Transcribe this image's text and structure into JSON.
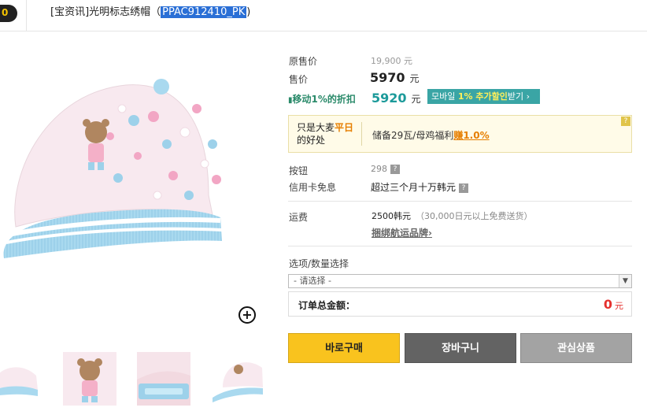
{
  "header": {
    "badge": "0",
    "title_prefix": "[宝资讯]光明标志绣帽（",
    "product_code": "PPAC912410_PK",
    "title_suffix": ")"
  },
  "prices": {
    "original_label": "原售价",
    "original_value": "19,900 元",
    "sale_label": "售价",
    "sale_value": "5970",
    "sale_unit": "元",
    "mobile_label": "移动1%的折扣",
    "mobile_value": "5920",
    "mobile_unit": "元",
    "mobile_btn_prefix": "모바일 ",
    "mobile_btn_highlight": "1% 추가할인",
    "mobile_btn_suffix": "받기 ›"
  },
  "promo": {
    "left_prefix": "只是大麦",
    "left_highlight": "平日",
    "left_suffix": "的好处",
    "right_prefix": "储备29瓦/母鸡福利",
    "right_highlight": "赚1.0%",
    "question": "?"
  },
  "info": {
    "button_label": "按钮",
    "button_value": "298",
    "card_label": "信用卡免息",
    "card_value": "超过三个月十万韩元",
    "shipping_label": "运费",
    "shipping_value": "2500韩元",
    "shipping_note": "（30,000日元以上免费送货）",
    "shipping_link": "捆绑航运品牌",
    "link_arrow": "›",
    "q": "?"
  },
  "options": {
    "label": "选项/数量选择",
    "select_value": "- 请选择 -",
    "arrow": "▼"
  },
  "total": {
    "label": "订单总金额：",
    "value": "0",
    "unit": "元"
  },
  "buttons": {
    "buy": "바로구매",
    "cart": "장바구니",
    "wish": "관심상품"
  },
  "zoom_symbol": "+"
}
